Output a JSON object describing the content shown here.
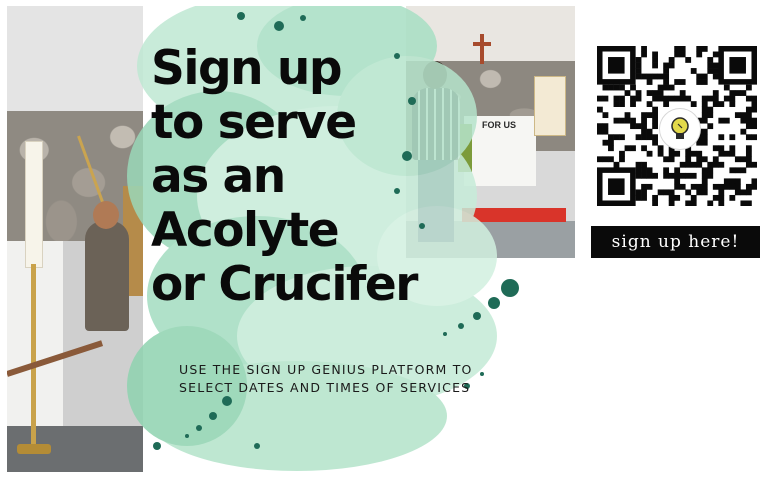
{
  "flyer": {
    "headline_lines": [
      "Sign up",
      "to serve",
      "as an",
      "Acolyte",
      "or Crucifer"
    ],
    "subtext_lines": [
      "USE THE SIGN UP GENIUS PLATFORM TO",
      "SELECT DATES AND TIMES OF SERVICES"
    ],
    "altar_sign": "FOR US"
  },
  "qr": {
    "icon": "qr-code-icon",
    "logo_icon": "lightbulb-icon"
  },
  "cta": {
    "label": "sign up here!"
  },
  "colors": {
    "splash_green": "#8fd3b0",
    "splash_light": "#c7ecd9",
    "dots": "#1f6b57",
    "text": "#0a0a0a",
    "button_bg": "#0a0a0a",
    "button_text": "#ffffff",
    "bulb": "#e3d94a"
  }
}
